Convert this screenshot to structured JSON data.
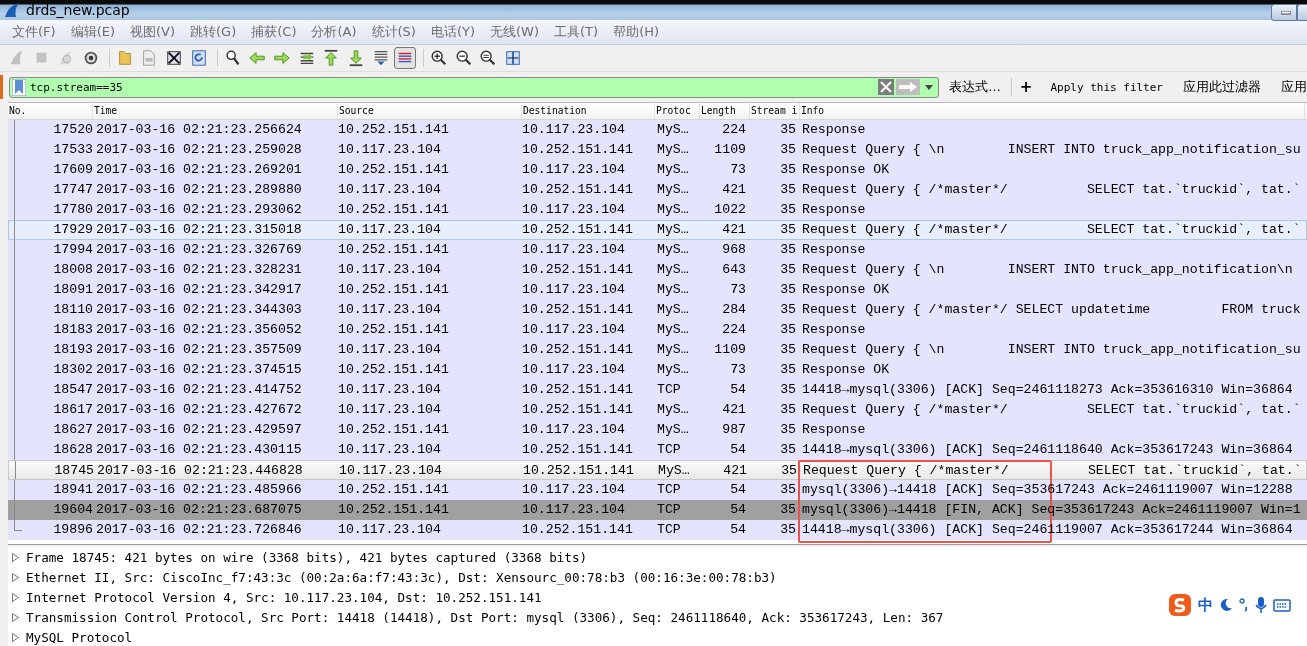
{
  "window": {
    "title": "drds_new.pcap"
  },
  "menu": [
    "文件(F)",
    "编辑(E)",
    "视图(V)",
    "跳转(G)",
    "捕获(C)",
    "分析(A)",
    "统计(S)",
    "电话(Y)",
    "无线(W)",
    "工具(T)",
    "帮助(H)"
  ],
  "toolbar": [
    {
      "disabled": true,
      "pressed": false
    },
    {
      "disabled": true,
      "pressed": false
    },
    {
      "disabled": true,
      "pressed": false
    },
    {
      "disabled": false,
      "pressed": false
    },
    {
      "disabled": false,
      "pressed": false
    },
    {
      "disabled": false,
      "pressed": false
    },
    {
      "disabled": false,
      "pressed": false
    },
    {
      "disabled": false,
      "pressed": false
    },
    {
      "disabled": false,
      "pressed": false
    },
    {
      "disabled": false,
      "pressed": false
    },
    {
      "disabled": false,
      "pressed": false
    },
    {
      "disabled": false,
      "pressed": false
    },
    {
      "disabled": false,
      "pressed": false
    },
    {
      "disabled": false,
      "pressed": false
    },
    {
      "disabled": false,
      "pressed": false
    },
    {
      "disabled": false,
      "pressed": true
    },
    {
      "disabled": false,
      "pressed": false
    },
    {
      "disabled": false,
      "pressed": false
    },
    {
      "disabled": false,
      "pressed": false
    },
    {
      "disabled": false,
      "pressed": false
    }
  ],
  "filter": {
    "value": "tcp.stream==35",
    "buttons": [
      "表达式…",
      "+",
      "Apply this filter",
      "应用此过滤器",
      "应用"
    ]
  },
  "packet_list": {
    "columns": [
      "No.",
      "Time",
      "Source",
      "Destination",
      "Protoc",
      "Length",
      "Stream i",
      "Info"
    ],
    "rows": [
      {
        "no": "17520",
        "time": "2017-03-16 02:21:23.256624",
        "source": "10.252.151.141",
        "destination": "10.117.23.104",
        "protocol": "MyS…",
        "length": "224",
        "stream": "35",
        "info": "Response",
        "color": "#e4e4fc",
        "selected": false,
        "hovered": false
      },
      {
        "no": "17533",
        "time": "2017-03-16 02:21:23.259028",
        "source": "10.117.23.104",
        "destination": "10.252.151.141",
        "protocol": "MyS…",
        "length": "1109",
        "stream": "35",
        "info": "Request Query { \\n        INSERT INTO truck_app_notification_su",
        "color": "#e4e4fc",
        "selected": false,
        "hovered": false
      },
      {
        "no": "17609",
        "time": "2017-03-16 02:21:23.269201",
        "source": "10.252.151.141",
        "destination": "10.117.23.104",
        "protocol": "MyS…",
        "length": "73",
        "stream": "35",
        "info": "Response OK",
        "color": "#e4e4fc",
        "selected": false,
        "hovered": false
      },
      {
        "no": "17747",
        "time": "2017-03-16 02:21:23.289880",
        "source": "10.117.23.104",
        "destination": "10.252.151.141",
        "protocol": "MyS…",
        "length": "421",
        "stream": "35",
        "info": "Request Query { /*master*/          SELECT tat.`truckid`, tat.`",
        "color": "#e4e4fc",
        "selected": false,
        "hovered": false
      },
      {
        "no": "17780",
        "time": "2017-03-16 02:21:23.293062",
        "source": "10.252.151.141",
        "destination": "10.117.23.104",
        "protocol": "MyS…",
        "length": "1022",
        "stream": "35",
        "info": "Response",
        "color": "#e4e4fc",
        "selected": false,
        "hovered": false
      },
      {
        "no": "17929",
        "time": "2017-03-16 02:21:23.315018",
        "source": "10.117.23.104",
        "destination": "10.252.151.141",
        "protocol": "MyS…",
        "length": "421",
        "stream": "35",
        "info": "Request Query { /*master*/          SELECT tat.`truckid`, tat.`",
        "color": "#e4e4fc",
        "selected": false,
        "hovered": true
      },
      {
        "no": "17994",
        "time": "2017-03-16 02:21:23.326769",
        "source": "10.252.151.141",
        "destination": "10.117.23.104",
        "protocol": "MyS…",
        "length": "968",
        "stream": "35",
        "info": "Response",
        "color": "#e4e4fc",
        "selected": false,
        "hovered": false
      },
      {
        "no": "18008",
        "time": "2017-03-16 02:21:23.328231",
        "source": "10.117.23.104",
        "destination": "10.252.151.141",
        "protocol": "MyS…",
        "length": "643",
        "stream": "35",
        "info": "Request Query { \\n        INSERT INTO truck_app_notification\\n",
        "color": "#e4e4fc",
        "selected": false,
        "hovered": false
      },
      {
        "no": "18091",
        "time": "2017-03-16 02:21:23.342917",
        "source": "10.252.151.141",
        "destination": "10.117.23.104",
        "protocol": "MyS…",
        "length": "73",
        "stream": "35",
        "info": "Response OK",
        "color": "#e4e4fc",
        "selected": false,
        "hovered": false
      },
      {
        "no": "18110",
        "time": "2017-03-16 02:21:23.344303",
        "source": "10.117.23.104",
        "destination": "10.252.151.141",
        "protocol": "MyS…",
        "length": "284",
        "stream": "35",
        "info": "Request Query { /*master*/ SELECT updatetime         FROM truck",
        "color": "#e4e4fc",
        "selected": false,
        "hovered": false
      },
      {
        "no": "18183",
        "time": "2017-03-16 02:21:23.356052",
        "source": "10.252.151.141",
        "destination": "10.117.23.104",
        "protocol": "MyS…",
        "length": "224",
        "stream": "35",
        "info": "Response",
        "color": "#e4e4fc",
        "selected": false,
        "hovered": false
      },
      {
        "no": "18193",
        "time": "2017-03-16 02:21:23.357509",
        "source": "10.117.23.104",
        "destination": "10.252.151.141",
        "protocol": "MyS…",
        "length": "1109",
        "stream": "35",
        "info": "Request Query { \\n        INSERT INTO truck_app_notification_su",
        "color": "#e4e4fc",
        "selected": false,
        "hovered": false
      },
      {
        "no": "18302",
        "time": "2017-03-16 02:21:23.374515",
        "source": "10.252.151.141",
        "destination": "10.117.23.104",
        "protocol": "MyS…",
        "length": "73",
        "stream": "35",
        "info": "Response OK",
        "color": "#e4e4fc",
        "selected": false,
        "hovered": false
      },
      {
        "no": "18547",
        "time": "2017-03-16 02:21:23.414752",
        "source": "10.117.23.104",
        "destination": "10.252.151.141",
        "protocol": "TCP",
        "length": "54",
        "stream": "35",
        "info": "14418→mysql(3306) [ACK] Seq=2461118273 Ack=353616310 Win=36864",
        "color": "#e4e4fc",
        "selected": false,
        "hovered": false
      },
      {
        "no": "18617",
        "time": "2017-03-16 02:21:23.427672",
        "source": "10.117.23.104",
        "destination": "10.252.151.141",
        "protocol": "MyS…",
        "length": "421",
        "stream": "35",
        "info": "Request Query { /*master*/          SELECT tat.`truckid`, tat.`",
        "color": "#e4e4fc",
        "selected": false,
        "hovered": false
      },
      {
        "no": "18627",
        "time": "2017-03-16 02:21:23.429597",
        "source": "10.252.151.141",
        "destination": "10.117.23.104",
        "protocol": "MyS…",
        "length": "987",
        "stream": "35",
        "info": "Response",
        "color": "#e4e4fc",
        "selected": false,
        "hovered": false
      },
      {
        "no": "18628",
        "time": "2017-03-16 02:21:23.430115",
        "source": "10.117.23.104",
        "destination": "10.252.151.141",
        "protocol": "TCP",
        "length": "54",
        "stream": "35",
        "info": "14418→mysql(3306) [ACK] Seq=2461118640 Ack=353617243 Win=36864",
        "color": "#e4e4fc",
        "selected": false,
        "hovered": false
      },
      {
        "no": "18745",
        "time": "2017-03-16 02:21:23.446828",
        "source": "10.117.23.104",
        "destination": "10.252.151.141",
        "protocol": "MyS…",
        "length": "421",
        "stream": "35",
        "info": "Request Query { /*master*/          SELECT tat.`truckid`, tat.`",
        "color": "#e4e4fc",
        "selected": true,
        "hovered": false
      },
      {
        "no": "18941",
        "time": "2017-03-16 02:21:23.485966",
        "source": "10.252.151.141",
        "destination": "10.117.23.104",
        "protocol": "TCP",
        "length": "54",
        "stream": "35",
        "info": "mysql(3306)→14418 [ACK] Seq=353617243 Ack=2461119007 Win=12288",
        "color": "#e4e4fc",
        "selected": false,
        "hovered": false
      },
      {
        "no": "19604",
        "time": "2017-03-16 02:21:23.687075",
        "source": "10.252.151.141",
        "destination": "10.117.23.104",
        "protocol": "TCP",
        "length": "54",
        "stream": "35",
        "info": "mysql(3306)→14418 [FIN, ACK] Seq=353617243 Ack=2461119007 Win=1",
        "color": "#a0a0a0",
        "selected": false,
        "hovered": false
      },
      {
        "no": "19896",
        "time": "2017-03-16 02:21:23.726846",
        "source": "10.117.23.104",
        "destination": "10.252.151.141",
        "protocol": "TCP",
        "length": "54",
        "stream": "35",
        "info": "14418→mysql(3306) [ACK] Seq=2461119007 Ack=353617244 Win=36864",
        "color": "#e4e4fc",
        "selected": false,
        "hovered": false
      }
    ]
  },
  "details": [
    {
      "text": "Frame 18745: 421 bytes on wire (3368 bits), 421 bytes captured (3368 bits)",
      "expanded": false
    },
    {
      "text": "Ethernet II, Src: CiscoInc_f7:43:3c (00:2a:6a:f7:43:3c), Dst: Xensourc_00:78:b3 (00:16:3e:00:78:b3)",
      "expanded": false
    },
    {
      "text": "Internet Protocol Version 4, Src: 10.117.23.104, Dst: 10.252.151.141",
      "expanded": false
    },
    {
      "text": "Transmission Control Protocol, Src Port: 14418 (14418), Dst Port: mysql (3306), Seq: 2461118640, Ack: 353617243, Len: 367",
      "expanded": false
    },
    {
      "text": "MySQL Protocol",
      "expanded": false
    }
  ],
  "ime": {
    "mode": "中"
  }
}
